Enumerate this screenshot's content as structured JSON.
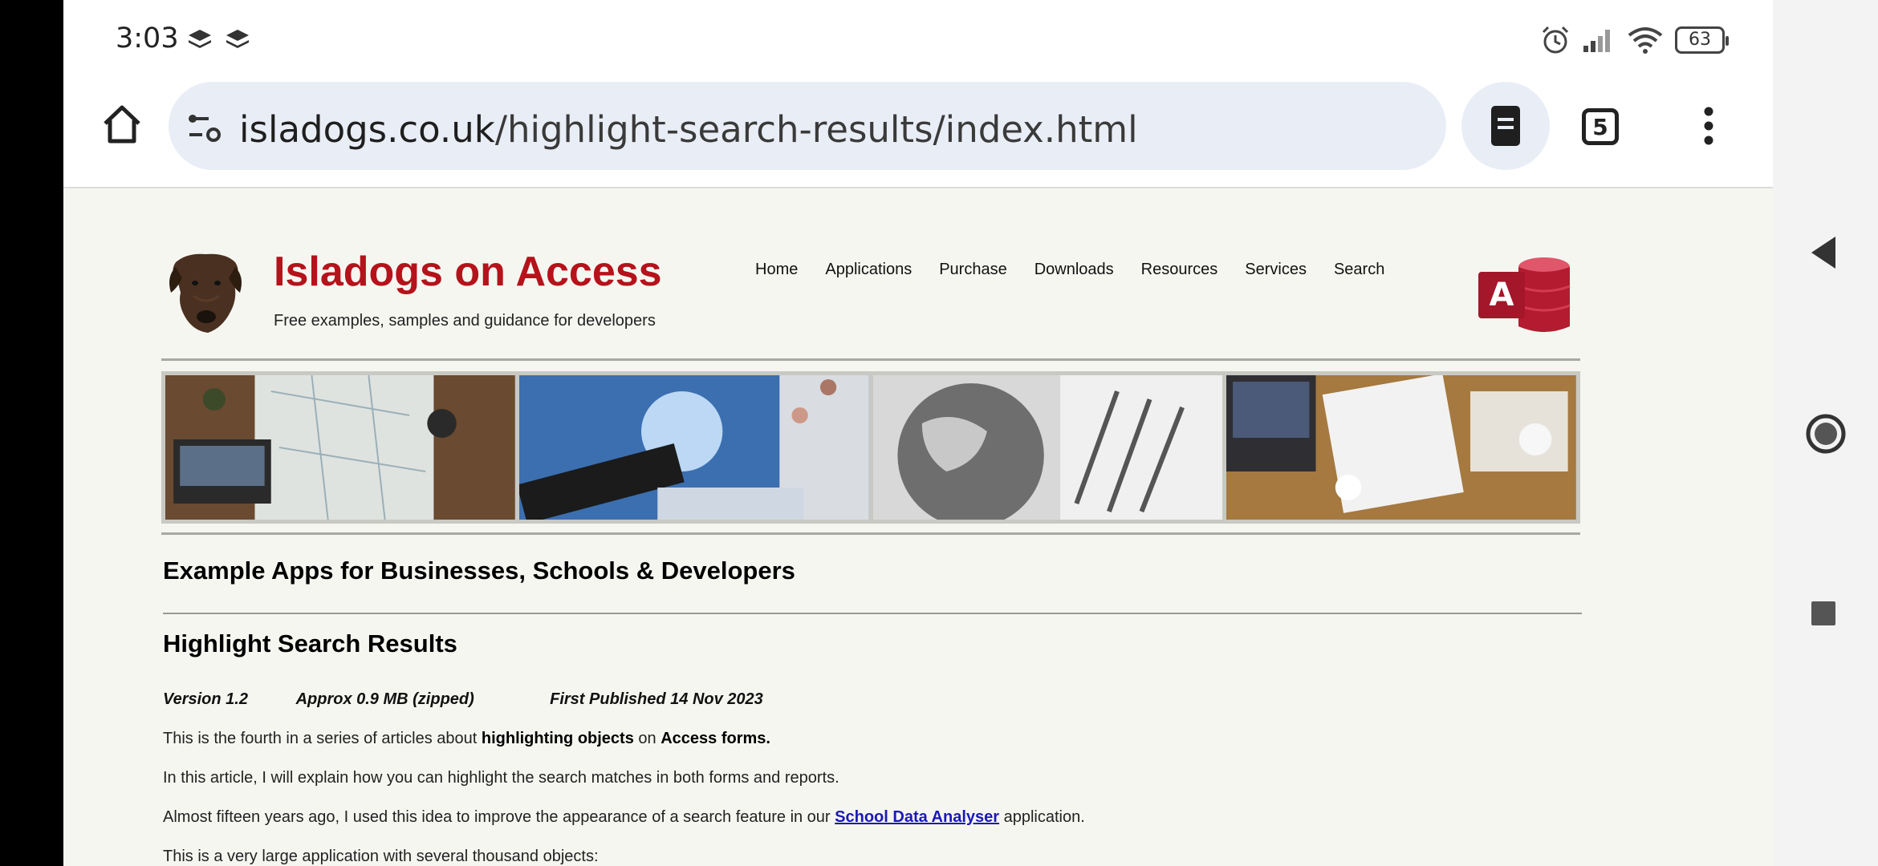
{
  "status": {
    "time": "3:03",
    "battery": "63"
  },
  "browser": {
    "url_domain": "isladogs.co.uk",
    "url_path": "/highlight-search-results/index.html",
    "tab_count": "5"
  },
  "site": {
    "title": "Isladogs on Access",
    "tagline": "Free examples, samples and guidance for developers",
    "access_logo_letter": "A",
    "nav": [
      "Home",
      "Applications",
      "Purchase",
      "Downloads",
      "Resources",
      "Services",
      "Search"
    ]
  },
  "content": {
    "section_heading": "Example Apps for Businesses, Schools & Developers",
    "article_title": "Highlight Search Results",
    "version": "Version 1.2",
    "size": "Approx 0.9 MB (zipped)",
    "published": "First Published 14 Nov 2023",
    "p1_a": "This is the fourth in a series of articles about ",
    "p1_b": "highlighting objects",
    "p1_c": " on ",
    "p1_d": "Access forms.",
    "p2": "In this article, I will explain how you can highlight the search matches in both forms and reports.",
    "p3_a": "Almost fifteen years ago, I used this idea to improve the appearance of a search feature in our ",
    "p3_link": "School Data Analyser",
    "p3_c": " application.",
    "p4": "This is a very large application with several thousand objects:"
  },
  "colors": {
    "brand_red": "#b5121b",
    "url_bg": "#e9eef6",
    "link": "#1a1ab5"
  }
}
